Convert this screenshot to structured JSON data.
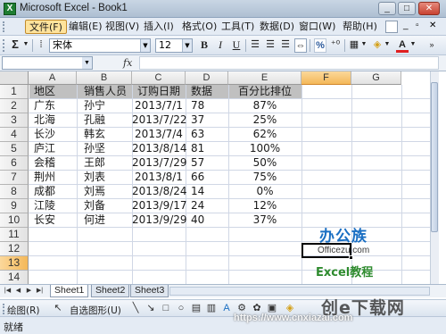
{
  "window": {
    "title": "Microsoft Excel - Book1",
    "icon_letter": "X",
    "min": "_",
    "max": "□",
    "close": "✕"
  },
  "menubar": {
    "items": [
      "文件(F)",
      "编辑(E)",
      "视图(V)",
      "插入(I)",
      "格式(O)",
      "工具(T)",
      "数据(D)",
      "窗口(W)",
      "帮助(H)"
    ]
  },
  "toolbar": {
    "sum": "Σ",
    "font_name": "宋体",
    "font_size": "12",
    "bold": "B",
    "italic": "I",
    "underline": "U",
    "percent": "%",
    "font_color_letter": "A"
  },
  "formula_bar": {
    "namebox": "",
    "fx": "fx",
    "value": ""
  },
  "columns": [
    "A",
    "B",
    "C",
    "D",
    "E",
    "F",
    "G"
  ],
  "selected_column": "F",
  "rows": [
    "1",
    "2",
    "3",
    "4",
    "5",
    "6",
    "7",
    "8",
    "9",
    "10",
    "11",
    "12",
    "13",
    "14"
  ],
  "selected_row": "13",
  "table": {
    "headers": [
      "地区",
      "销售人员",
      "订购日期",
      "数据",
      "百分比排位"
    ],
    "rows": [
      [
        "广东",
        "孙宁",
        "2013/7/1",
        "78",
        "87%"
      ],
      [
        "北海",
        "孔融",
        "2013/7/22",
        "37",
        "25%"
      ],
      [
        "长沙",
        "韩玄",
        "2013/7/4",
        "63",
        "62%"
      ],
      [
        "庐江",
        "孙坚",
        "2013/8/14",
        "81",
        "100%"
      ],
      [
        "会稽",
        "王郎",
        "2013/7/29",
        "57",
        "50%"
      ],
      [
        "荆州",
        "刘表",
        "2013/8/1",
        "66",
        "75%"
      ],
      [
        "成都",
        "刘焉",
        "2013/8/24",
        "14",
        "0%"
      ],
      [
        "江陵",
        "刘备",
        "2013/9/17",
        "24",
        "12%"
      ],
      [
        "长安",
        "何进",
        "2013/9/29",
        "40",
        "37%"
      ]
    ]
  },
  "sheets": [
    "Sheet1",
    "Sheet2",
    "Sheet3"
  ],
  "active_sheet": "Sheet1",
  "drawing_bar": {
    "draw_label": "绘图(R)",
    "autoshapes_label": "自选图形(U)"
  },
  "status": "就绪",
  "logo": {
    "cn": "办公族",
    "url": "Officezu.com",
    "excel": "Excel教程"
  },
  "watermark": {
    "text": "创e下载网",
    "url": "https://www.cnxiazai.com"
  }
}
